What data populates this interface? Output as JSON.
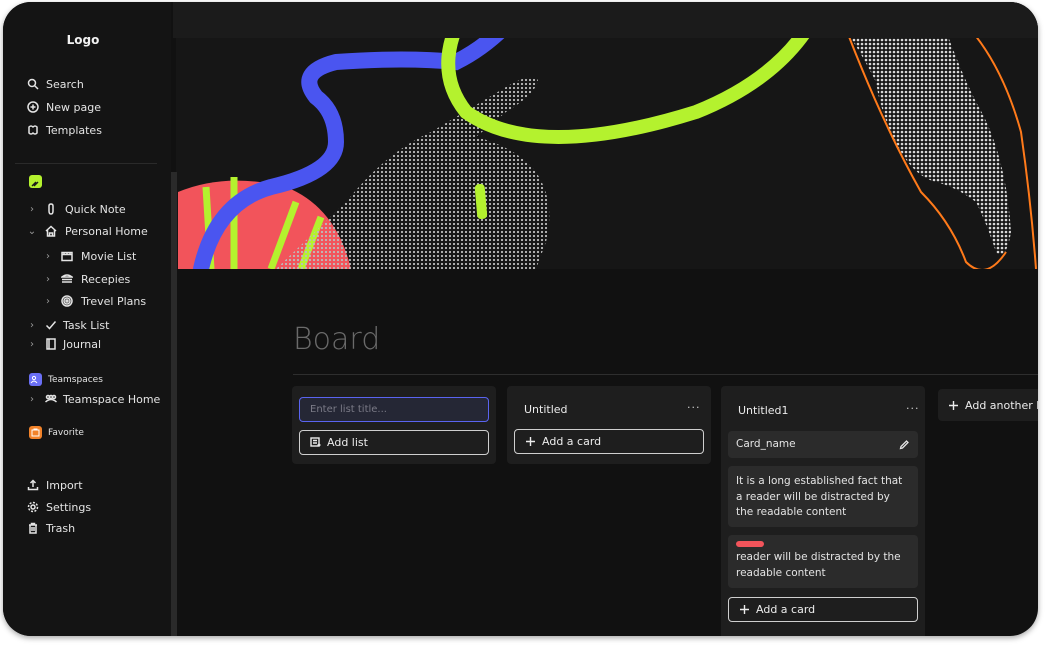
{
  "sidebar": {
    "logo": "Logo",
    "nav": [
      {
        "label": "Search",
        "icon": "search-icon"
      },
      {
        "label": "New page",
        "icon": "plus-circle-icon"
      },
      {
        "label": "Templates",
        "icon": "templates-icon"
      }
    ],
    "tree": [
      {
        "label": "Quick Note",
        "icon": "paperclip-icon"
      },
      {
        "label": "Personal Home",
        "icon": "home-icon"
      },
      {
        "label": "Movie List",
        "icon": "film-icon"
      },
      {
        "label": "Recepies",
        "icon": "stack-icon"
      },
      {
        "label": "Trevel Plans",
        "icon": "target-icon"
      },
      {
        "label": "Task List",
        "icon": "check-icon"
      },
      {
        "label": "Journal",
        "icon": "book-icon"
      }
    ],
    "teamspaces_label": "Teamspaces",
    "teamspace_home": "Teamspace Home",
    "favorite_label": "Favorite",
    "bottom": [
      {
        "label": "Import",
        "icon": "upload-icon"
      },
      {
        "label": "Settings",
        "icon": "gear-icon"
      },
      {
        "label": "Trash",
        "icon": "trash-icon"
      }
    ]
  },
  "colors": {
    "accent_green": "#b4f22e",
    "accent_blue": "#4a55f0",
    "accent_orange": "#f2832a",
    "accent_red": "#f2545b",
    "banner_orange": "#ff7a1a"
  },
  "board": {
    "title": "Board",
    "new_list": {
      "placeholder": "Enter list title...",
      "add_label": "Add list"
    },
    "lists": [
      {
        "title": "Untitled",
        "menu": "···",
        "add_card": "Add a card"
      },
      {
        "title": "Untitled1",
        "menu": "···",
        "cards": [
          {
            "text": "Card_name"
          },
          {
            "text": "It is a long established fact that a reader will be distracted by the readable content"
          },
          {
            "text": "reader will be distracted by the readable content",
            "label_color": "#f2545b"
          }
        ],
        "add_card": "Add a card"
      }
    ],
    "add_another": "Add another list"
  }
}
